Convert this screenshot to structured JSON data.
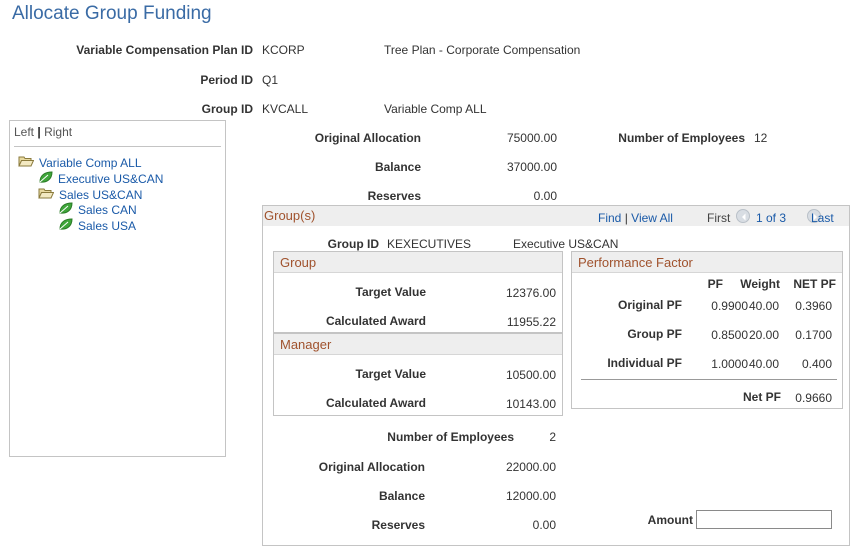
{
  "page": {
    "title": "Allocate Group Funding"
  },
  "header": {
    "plan_label": "Variable Compensation Plan ID",
    "plan_id": "KCORP",
    "plan_desc": "Tree Plan - Corporate Compensation",
    "period_label": "Period ID",
    "period_id": "Q1",
    "group_label": "Group ID",
    "group_id": "KVCALL",
    "group_desc": "Variable Comp ALL"
  },
  "tree": {
    "left": "Left",
    "separator": "|",
    "right": "Right",
    "nodes": [
      {
        "label": "Variable Comp ALL",
        "icon": "folder-open-icon"
      },
      {
        "label": "Executive US&CAN",
        "icon": "leaf-icon"
      },
      {
        "label": "Sales US&CAN",
        "icon": "folder-open-icon"
      },
      {
        "label": "Sales CAN",
        "icon": "leaf-icon"
      },
      {
        "label": "Sales USA",
        "icon": "leaf-icon"
      }
    ]
  },
  "totals": {
    "original_allocation_label": "Original Allocation",
    "original_allocation": "75000.00",
    "balance_label": "Balance",
    "balance": "37000.00",
    "reserves_label": "Reserves",
    "reserves": "0.00",
    "employees_label": "Number of Employees",
    "employees": "12"
  },
  "groups": {
    "title": "Group(s)",
    "find": "Find",
    "nav_sep": "|",
    "view_all": "View All",
    "first": "First",
    "page_info": "1 of 3",
    "last": "Last",
    "group_id_label": "Group ID",
    "group_id": "KEXECUTIVES",
    "group_desc": "Executive US&CAN",
    "group_section": {
      "title": "Group",
      "target_label": "Target Value",
      "target": "12376.00",
      "award_label": "Calculated Award",
      "award": "11955.22"
    },
    "manager_section": {
      "title": "Manager",
      "target_label": "Target Value",
      "target": "10500.00",
      "award_label": "Calculated Award",
      "award": "10143.00"
    },
    "performance": {
      "title": "Performance Factor",
      "columns": [
        "PF",
        "Weight",
        "NET PF"
      ],
      "rows": [
        {
          "label": "Original PF",
          "pf": "0.9900",
          "weight": "40.00",
          "net": "0.3960"
        },
        {
          "label": "Group PF",
          "pf": "0.8500",
          "weight": "20.00",
          "net": "0.1700"
        },
        {
          "label": "Individual PF",
          "pf": "1.0000",
          "weight": "40.00",
          "net": "0.400"
        }
      ],
      "net_pf_label": "Net PF",
      "net_pf": "0.9660"
    },
    "employees_label": "Number of Employees",
    "employees": "2",
    "original_allocation_label": "Original Allocation",
    "original_allocation": "22000.00",
    "balance_label": "Balance",
    "balance": "12000.00",
    "reserves_label": "Reserves",
    "reserves": "0.00",
    "amount_label": "Amount",
    "amount_value": ""
  }
}
